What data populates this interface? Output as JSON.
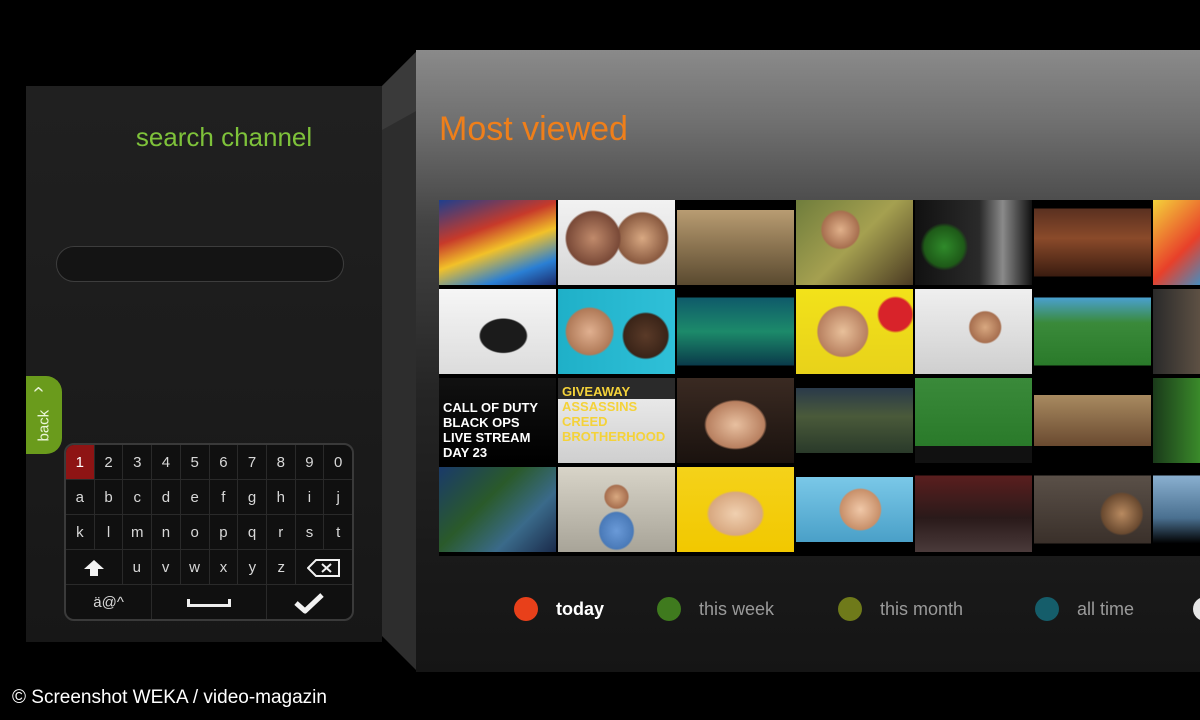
{
  "left_panel": {
    "title": "search channel",
    "search_value": "",
    "back_label": "back",
    "back_chevron": "‹",
    "keyboard": {
      "row1": [
        "1",
        "2",
        "3",
        "4",
        "5",
        "6",
        "7",
        "8",
        "9",
        "0"
      ],
      "row2": [
        "a",
        "b",
        "c",
        "d",
        "e",
        "f",
        "g",
        "h",
        "i",
        "j"
      ],
      "row3": [
        "k",
        "l",
        "m",
        "n",
        "o",
        "p",
        "q",
        "r",
        "s",
        "t"
      ],
      "row4": [
        "u",
        "v",
        "w",
        "x",
        "y",
        "z"
      ],
      "symbols_key": "ä@^",
      "shift_icon": "up-arrow-icon",
      "backspace_icon": "backspace-icon",
      "confirm_icon": "checkmark-icon",
      "active_key": "1"
    }
  },
  "main": {
    "title": "Most viewed",
    "thumbnails": [
      {
        "caption": ""
      },
      {
        "caption": ""
      },
      {
        "caption": ""
      },
      {
        "caption": ""
      },
      {
        "caption": ""
      },
      {
        "caption": ""
      },
      {
        "caption": ""
      },
      {
        "caption": ""
      },
      {
        "caption": ""
      },
      {
        "caption": ""
      },
      {
        "caption": ""
      },
      {
        "caption": ""
      },
      {
        "caption": ""
      },
      {
        "caption": ""
      },
      {
        "caption": "CALL OF DUTY BLACK OPS LIVE STREAM DAY 23"
      },
      {
        "caption": "GIVEAWAY ASSASSINS CREED BROTHERHOOD"
      },
      {
        "caption": ""
      },
      {
        "caption": ""
      },
      {
        "caption": ""
      },
      {
        "caption": ""
      },
      {
        "caption": ""
      },
      {
        "caption": ""
      },
      {
        "caption": ""
      },
      {
        "caption": ""
      },
      {
        "caption": ""
      },
      {
        "caption": ""
      },
      {
        "caption": ""
      },
      {
        "caption": ""
      }
    ],
    "filters": [
      {
        "label": "today",
        "color": "#e8401a",
        "selected": true
      },
      {
        "label": "this week",
        "color": "#3f7a1e",
        "selected": false
      },
      {
        "label": "this month",
        "color": "#6f7a1a",
        "selected": false
      },
      {
        "label": "all time",
        "color": "#155d6a",
        "selected": false
      }
    ]
  },
  "credit": "© Screenshot WEKA / video-magazin",
  "colors": {
    "accent_green": "#7ec23a",
    "title_orange": "#ef7f1a",
    "back_tab": "#6a9b1c",
    "active_key": "#8e1414"
  }
}
